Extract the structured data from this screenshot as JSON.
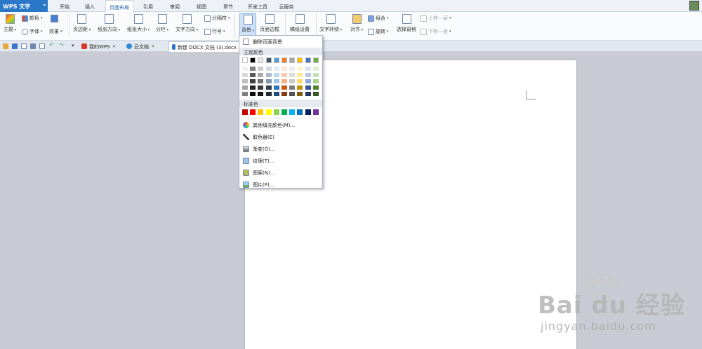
{
  "app": {
    "title": "WPS 文字"
  },
  "menu": {
    "tabs": [
      {
        "label": "开始"
      },
      {
        "label": "插入"
      },
      {
        "label": "页面布局",
        "active": true
      },
      {
        "label": "引用"
      },
      {
        "label": "审阅"
      },
      {
        "label": "视图"
      },
      {
        "label": "章节"
      },
      {
        "label": "开发工具"
      },
      {
        "label": "云服务"
      }
    ]
  },
  "ribbon": {
    "theme": "主题",
    "colors": "颜色",
    "fonts": "字体",
    "effects": "效果",
    "margins": "页边距",
    "orientation": "纸张方向",
    "size": "纸张大小",
    "columns": "分栏",
    "text_direction": "文字方向",
    "separator": "分隔符",
    "line_numbers": "行号",
    "background": "背景",
    "page_border": "页面边框",
    "draft_settings": "稿纸设置",
    "text_wrap": "文字环绕",
    "align": "对齐",
    "rotate": "旋转",
    "group": "组合",
    "selection_pane": "选择窗格",
    "bring_forward": "上移一层",
    "send_backward": "下移一层"
  },
  "tabs": {
    "my_wps": "我的WPS",
    "cloud_docs": "云文档",
    "current_doc": "新建 DOCX 文档 (3).docx"
  },
  "background_menu": {
    "remove_background": "删除页面背景",
    "theme_colors_header": "主题颜色",
    "standard_colors_header": "标准色",
    "more_colors": "其他填充颜色(M)...",
    "eyedropper": "取色器(E)",
    "gradient": "渐变(G)...",
    "texture": "纹理(T)...",
    "pattern": "图案(N)...",
    "picture": "图片(P)...",
    "theme_top_row": [
      "#ffffff",
      "#000000",
      "#e7e6e6",
      "#44546a",
      "#5b9bd5",
      "#ed7d31",
      "#a5a5a5",
      "#ffc000",
      "#4472c4",
      "#70ad47"
    ],
    "theme_columns": [
      [
        "#f2f2f2",
        "#d9d9d9",
        "#bfbfbf",
        "#a6a6a6",
        "#808080"
      ],
      [
        "#808080",
        "#595959",
        "#404040",
        "#262626",
        "#0d0d0d"
      ],
      [
        "#d0cece",
        "#aeaaaa",
        "#757171",
        "#3a3838",
        "#161616"
      ],
      [
        "#d6dce4",
        "#adb9ca",
        "#8497b0",
        "#333f4f",
        "#222a35"
      ],
      [
        "#ddebf7",
        "#bdd7ee",
        "#9dc3e6",
        "#2e75b6",
        "#1f4e79"
      ],
      [
        "#fbe5d6",
        "#f8cbad",
        "#f4b183",
        "#c55a11",
        "#843c0c"
      ],
      [
        "#ededed",
        "#dbdbdb",
        "#c9c9c9",
        "#7b7b7b",
        "#525252"
      ],
      [
        "#fff2cc",
        "#ffe699",
        "#ffd966",
        "#bf9000",
        "#7f6000"
      ],
      [
        "#dae3f3",
        "#b4c7e7",
        "#8faadc",
        "#2f5597",
        "#203864"
      ],
      [
        "#e2f0d9",
        "#c5e0b4",
        "#a9d18e",
        "#548235",
        "#385723"
      ]
    ],
    "standard_colors": [
      "#c00000",
      "#ff0000",
      "#ffc000",
      "#ffff00",
      "#92d050",
      "#00b050",
      "#00b0f0",
      "#0070c0",
      "#002060",
      "#7030a0"
    ]
  },
  "watermark": {
    "brand": "Bai du 经验",
    "url": "jingyan.baidu.com"
  }
}
